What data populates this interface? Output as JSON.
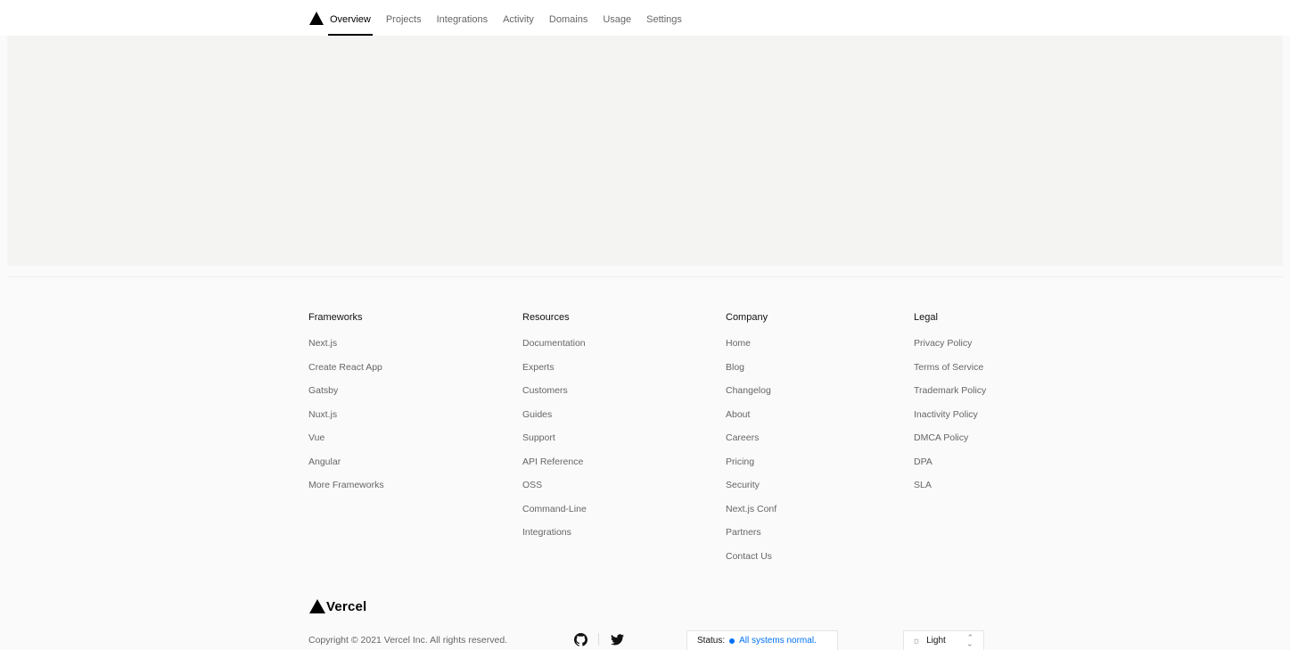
{
  "nav": {
    "tabs": [
      {
        "label": "Overview",
        "active": true
      },
      {
        "label": "Projects"
      },
      {
        "label": "Integrations"
      },
      {
        "label": "Activity"
      },
      {
        "label": "Domains"
      },
      {
        "label": "Usage"
      },
      {
        "label": "Settings"
      }
    ]
  },
  "footer": {
    "columns": [
      {
        "heading": "Frameworks",
        "links": [
          "Next.js",
          "Create React App",
          "Gatsby",
          "Nuxt.js",
          "Vue",
          "Angular",
          "More Frameworks"
        ]
      },
      {
        "heading": "Resources",
        "links": [
          "Documentation",
          "Experts",
          "Customers",
          "Guides",
          "Support",
          "API Reference",
          "OSS",
          "Command-Line",
          "Integrations"
        ]
      },
      {
        "heading": "Company",
        "links": [
          "Home",
          "Blog",
          "Changelog",
          "About",
          "Careers",
          "Pricing",
          "Security",
          "Next.js Conf",
          "Partners",
          "Contact Us"
        ]
      },
      {
        "heading": "Legal",
        "links": [
          "Privacy Policy",
          "Terms of Service",
          "Trademark Policy",
          "Inactivity Policy",
          "DMCA Policy",
          "DPA",
          "SLA"
        ]
      }
    ],
    "brand": "Vercel",
    "copyright": "Copyright © 2021 Vercel Inc. All rights reserved.",
    "social": [
      "github-icon",
      "twitter-icon"
    ],
    "status": {
      "label": "Status:",
      "text": "All systems normal.",
      "color": "#0070f3"
    },
    "theme": {
      "label": "Light",
      "icon": "sun-icon"
    }
  }
}
